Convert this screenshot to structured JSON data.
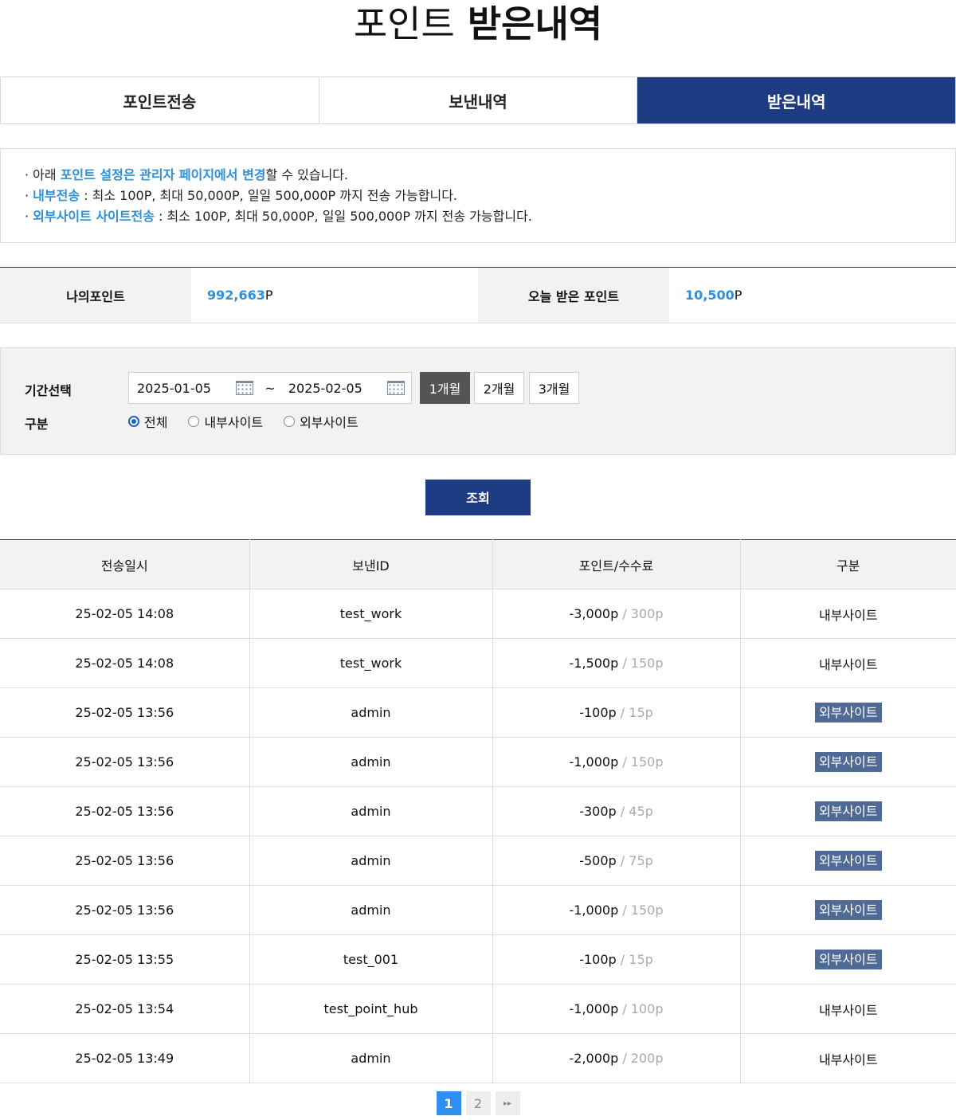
{
  "title": {
    "light": "포인트",
    "bold": "받은내역"
  },
  "tabs": [
    {
      "label": "포인트전송",
      "active": false
    },
    {
      "label": "보낸내역",
      "active": false
    },
    {
      "label": "받은내역",
      "active": true
    }
  ],
  "notice": {
    "line1": {
      "a": "· 아래 ",
      "b": "포인트 설정은 관리자 페이지에서 변경",
      "c": "할 수 있습니다."
    },
    "line2": {
      "a": "· ",
      "b": "내부전송",
      "c": " : 최소 100P, 최대 50,000P, 일일 500,000P 까지 전송 가능합니다."
    },
    "line3": {
      "a": "· ",
      "b": "외부사이트 사이트전송",
      "c": " : 최소 100P, 최대 50,000P, 일일 500,000P 까지 전송 가능합니다."
    }
  },
  "summary": {
    "my_label": "나의포인트",
    "my_value": "992,663",
    "my_unit": "P",
    "today_label": "오늘 받은 포인트",
    "today_value": "10,500",
    "today_unit": "P"
  },
  "filter": {
    "period_label": "기간선택",
    "start_date": "2025-01-05",
    "tilde": "~",
    "end_date": "2025-02-05",
    "buttons": [
      "1개월",
      "2개월",
      "3개월"
    ],
    "type_label": "구분",
    "radios": [
      "전체",
      "내부사이트",
      "외부사이트"
    ]
  },
  "search_label": "조회",
  "table": {
    "headers": [
      "전송일시",
      "보낸ID",
      "포인트/수수료",
      "구분"
    ],
    "rows": [
      {
        "date": "25-02-05 14:08",
        "id": "test_work",
        "point": "-3,000p",
        "fee": "/ 300p",
        "type": "내부사이트"
      },
      {
        "date": "25-02-05 14:08",
        "id": "test_work",
        "point": "-1,500p",
        "fee": "/ 150p",
        "type": "내부사이트"
      },
      {
        "date": "25-02-05 13:56",
        "id": "admin",
        "point": "-100p",
        "fee": "/ 15p",
        "type": "외부사이트"
      },
      {
        "date": "25-02-05 13:56",
        "id": "admin",
        "point": "-1,000p",
        "fee": "/ 150p",
        "type": "외부사이트"
      },
      {
        "date": "25-02-05 13:56",
        "id": "admin",
        "point": "-300p",
        "fee": "/ 45p",
        "type": "외부사이트"
      },
      {
        "date": "25-02-05 13:56",
        "id": "admin",
        "point": "-500p",
        "fee": "/ 75p",
        "type": "외부사이트"
      },
      {
        "date": "25-02-05 13:56",
        "id": "admin",
        "point": "-1,000p",
        "fee": "/ 150p",
        "type": "외부사이트"
      },
      {
        "date": "25-02-05 13:55",
        "id": "test_001",
        "point": "-100p",
        "fee": "/ 15p",
        "type": "외부사이트"
      },
      {
        "date": "25-02-05 13:54",
        "id": "test_point_hub",
        "point": "-1,000p",
        "fee": "/ 100p",
        "type": "내부사이트"
      },
      {
        "date": "25-02-05 13:49",
        "id": "admin",
        "point": "-2,000p",
        "fee": "/ 200p",
        "type": "내부사이트"
      }
    ]
  },
  "pagination": {
    "pages": [
      "1",
      "2"
    ],
    "next": "▸▸"
  },
  "colors": {
    "navy": "#1e3c84",
    "accent_blue": "#2e8fd6",
    "badge": "#4f6a94"
  }
}
